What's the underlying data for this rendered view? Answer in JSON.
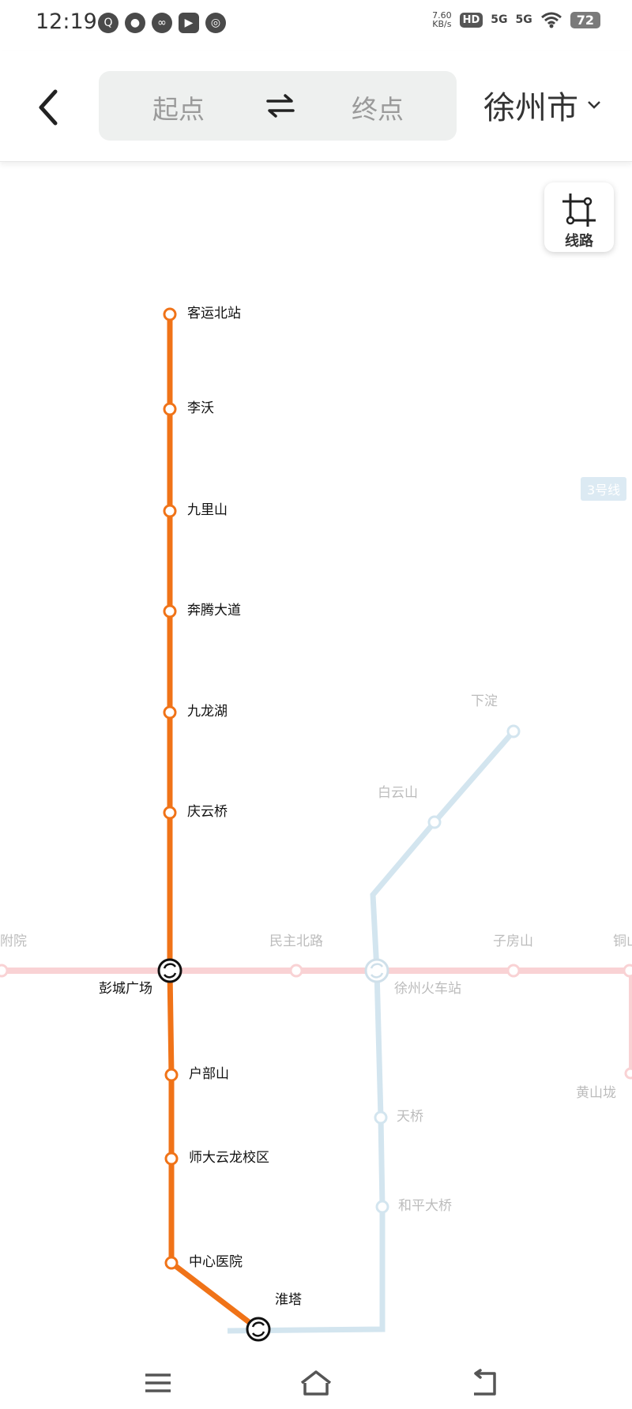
{
  "status_bar": {
    "time": "12:19",
    "net_speed_value": "7.60",
    "net_speed_unit": "KB/s",
    "hd_label": "HD",
    "sim1": "5G",
    "sim2": "5G",
    "battery": "72"
  },
  "header": {
    "start_placeholder": "起点",
    "end_placeholder": "终点",
    "city": "徐州市"
  },
  "route_button": {
    "label": "线路"
  },
  "map": {
    "line3_tag": "3号线",
    "line1_stations": [
      "客运北站",
      "李沃",
      "九里山",
      "奔腾大道",
      "九龙湖",
      "庆云桥",
      "彭城广场",
      "户部山",
      "师大云龙校区",
      "中心医院",
      "淮塔"
    ],
    "line2_stations": [
      "附院",
      "民主北路",
      "子房山",
      "铜山",
      "黄山垅"
    ],
    "line3_stations": [
      "下淀",
      "白云山",
      "徐州火车站",
      "天桥",
      "和平大桥"
    ]
  },
  "colors": {
    "line1": "#f07318",
    "line2": "#f9d2d4",
    "line3": "#d3e5ef",
    "faded_text": "#bcbcbc"
  },
  "icons": {
    "back": "chevron-left-icon",
    "swap": "swap-arrows-icon",
    "city_dropdown": "chevron-down-icon",
    "route": "route-crop-icon",
    "transfer": "transfer-cycle-icon",
    "menu": "menu-icon",
    "home": "home-icon",
    "return": "return-icon"
  }
}
